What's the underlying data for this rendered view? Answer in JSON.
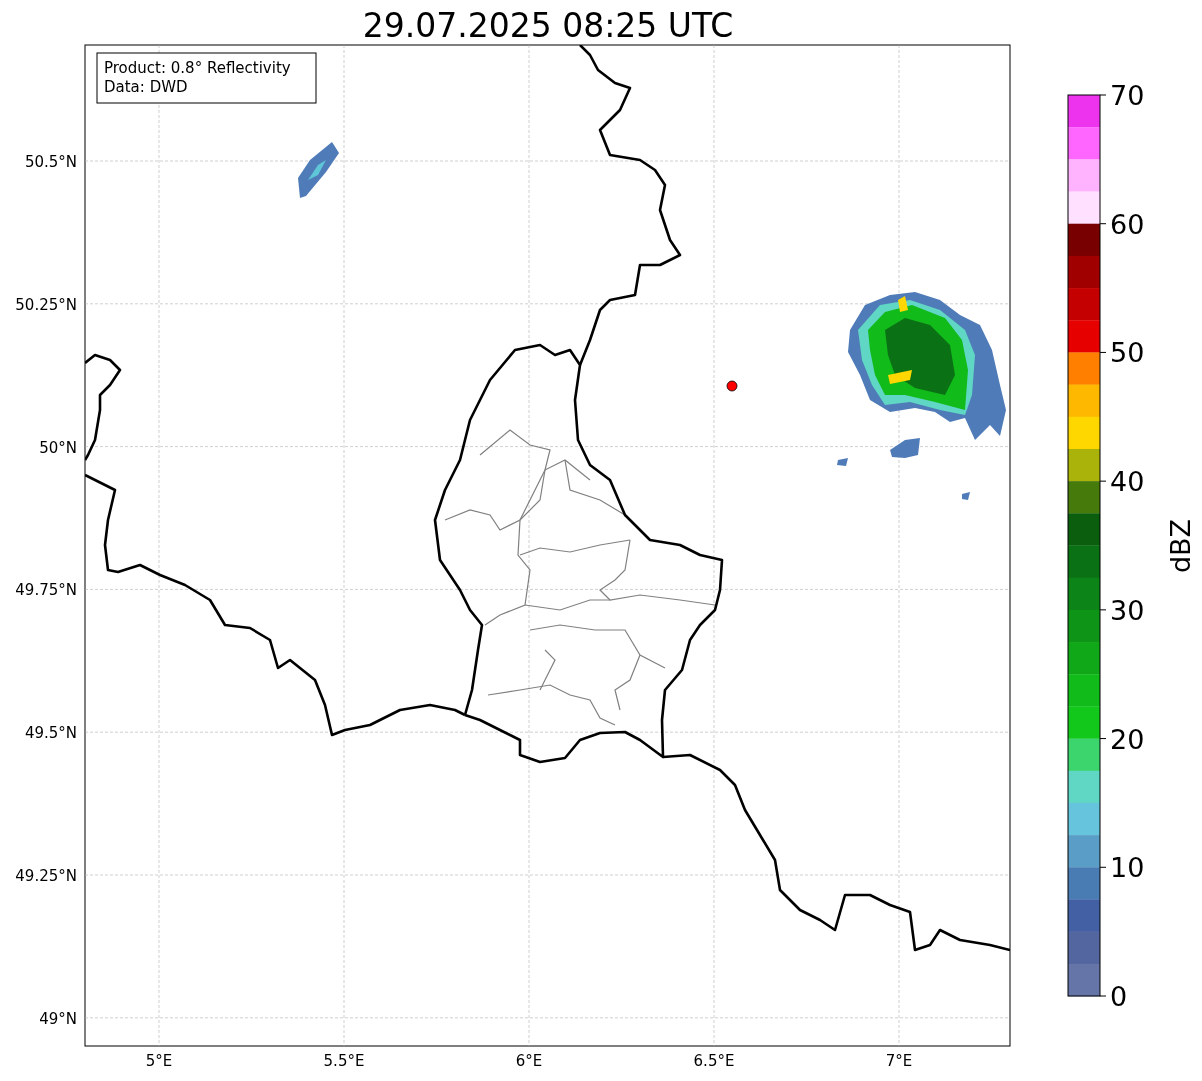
{
  "title": "29.07.2025 08:25 UTC",
  "info_box": {
    "lines": [
      "Product: 0.8° Reflectivity",
      "Data: DWD"
    ]
  },
  "map": {
    "y_ticks": [
      "50.5°N",
      "50.25°N",
      "50°N",
      "49.75°N",
      "49.5°N",
      "49.25°N",
      "49°N"
    ],
    "x_ticks": [
      "5°E",
      "5.5°E",
      "6°E",
      "6.5°E",
      "7°E"
    ]
  },
  "colorbar": {
    "label": "dBZ",
    "ticks": [
      "70",
      "60",
      "50",
      "40",
      "30",
      "20",
      "10",
      "0"
    ],
    "bins": [
      {
        "color": "#ee33ee"
      },
      {
        "color": "#ff66ff"
      },
      {
        "color": "#ffb3ff"
      },
      {
        "color": "#ffe0ff"
      },
      {
        "color": "#780000"
      },
      {
        "color": "#a00000"
      },
      {
        "color": "#c40000"
      },
      {
        "color": "#e60000"
      },
      {
        "color": "#ff8000"
      },
      {
        "color": "#ffb800"
      },
      {
        "color": "#ffd700"
      },
      {
        "color": "#aab30a"
      },
      {
        "color": "#467a0a"
      },
      {
        "color": "#0a5e0e"
      },
      {
        "color": "#0a7214"
      },
      {
        "color": "#0c8417"
      },
      {
        "color": "#0e9518"
      },
      {
        "color": "#10a818"
      },
      {
        "color": "#11bb1a"
      },
      {
        "color": "#12c81a"
      },
      {
        "color": "#3cd46c"
      },
      {
        "color": "#60d6c4"
      },
      {
        "color": "#66c4dc"
      },
      {
        "color": "#5a9ec8"
      },
      {
        "color": "#4a7cb4"
      },
      {
        "color": "#4460a4"
      },
      {
        "color": "#5466a0"
      },
      {
        "color": "#6675a8"
      }
    ]
  }
}
